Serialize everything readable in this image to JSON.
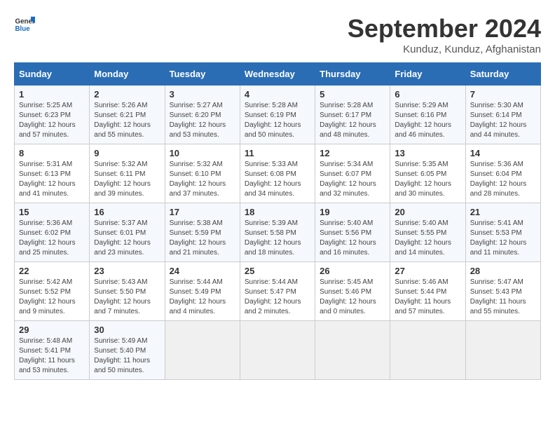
{
  "logo": {
    "line1": "General",
    "line2": "Blue"
  },
  "title": "September 2024",
  "subtitle": "Kunduz, Kunduz, Afghanistan",
  "days_header": [
    "Sunday",
    "Monday",
    "Tuesday",
    "Wednesday",
    "Thursday",
    "Friday",
    "Saturday"
  ],
  "weeks": [
    [
      {
        "num": "1",
        "sunrise": "5:25 AM",
        "sunset": "6:23 PM",
        "daylight": "12 hours and 57 minutes."
      },
      {
        "num": "2",
        "sunrise": "5:26 AM",
        "sunset": "6:21 PM",
        "daylight": "12 hours and 55 minutes."
      },
      {
        "num": "3",
        "sunrise": "5:27 AM",
        "sunset": "6:20 PM",
        "daylight": "12 hours and 53 minutes."
      },
      {
        "num": "4",
        "sunrise": "5:28 AM",
        "sunset": "6:19 PM",
        "daylight": "12 hours and 50 minutes."
      },
      {
        "num": "5",
        "sunrise": "5:28 AM",
        "sunset": "6:17 PM",
        "daylight": "12 hours and 48 minutes."
      },
      {
        "num": "6",
        "sunrise": "5:29 AM",
        "sunset": "6:16 PM",
        "daylight": "12 hours and 46 minutes."
      },
      {
        "num": "7",
        "sunrise": "5:30 AM",
        "sunset": "6:14 PM",
        "daylight": "12 hours and 44 minutes."
      }
    ],
    [
      {
        "num": "8",
        "sunrise": "5:31 AM",
        "sunset": "6:13 PM",
        "daylight": "12 hours and 41 minutes."
      },
      {
        "num": "9",
        "sunrise": "5:32 AM",
        "sunset": "6:11 PM",
        "daylight": "12 hours and 39 minutes."
      },
      {
        "num": "10",
        "sunrise": "5:32 AM",
        "sunset": "6:10 PM",
        "daylight": "12 hours and 37 minutes."
      },
      {
        "num": "11",
        "sunrise": "5:33 AM",
        "sunset": "6:08 PM",
        "daylight": "12 hours and 34 minutes."
      },
      {
        "num": "12",
        "sunrise": "5:34 AM",
        "sunset": "6:07 PM",
        "daylight": "12 hours and 32 minutes."
      },
      {
        "num": "13",
        "sunrise": "5:35 AM",
        "sunset": "6:05 PM",
        "daylight": "12 hours and 30 minutes."
      },
      {
        "num": "14",
        "sunrise": "5:36 AM",
        "sunset": "6:04 PM",
        "daylight": "12 hours and 28 minutes."
      }
    ],
    [
      {
        "num": "15",
        "sunrise": "5:36 AM",
        "sunset": "6:02 PM",
        "daylight": "12 hours and 25 minutes."
      },
      {
        "num": "16",
        "sunrise": "5:37 AM",
        "sunset": "6:01 PM",
        "daylight": "12 hours and 23 minutes."
      },
      {
        "num": "17",
        "sunrise": "5:38 AM",
        "sunset": "5:59 PM",
        "daylight": "12 hours and 21 minutes."
      },
      {
        "num": "18",
        "sunrise": "5:39 AM",
        "sunset": "5:58 PM",
        "daylight": "12 hours and 18 minutes."
      },
      {
        "num": "19",
        "sunrise": "5:40 AM",
        "sunset": "5:56 PM",
        "daylight": "12 hours and 16 minutes."
      },
      {
        "num": "20",
        "sunrise": "5:40 AM",
        "sunset": "5:55 PM",
        "daylight": "12 hours and 14 minutes."
      },
      {
        "num": "21",
        "sunrise": "5:41 AM",
        "sunset": "5:53 PM",
        "daylight": "12 hours and 11 minutes."
      }
    ],
    [
      {
        "num": "22",
        "sunrise": "5:42 AM",
        "sunset": "5:52 PM",
        "daylight": "12 hours and 9 minutes."
      },
      {
        "num": "23",
        "sunrise": "5:43 AM",
        "sunset": "5:50 PM",
        "daylight": "12 hours and 7 minutes."
      },
      {
        "num": "24",
        "sunrise": "5:44 AM",
        "sunset": "5:49 PM",
        "daylight": "12 hours and 4 minutes."
      },
      {
        "num": "25",
        "sunrise": "5:44 AM",
        "sunset": "5:47 PM",
        "daylight": "12 hours and 2 minutes."
      },
      {
        "num": "26",
        "sunrise": "5:45 AM",
        "sunset": "5:46 PM",
        "daylight": "12 hours and 0 minutes."
      },
      {
        "num": "27",
        "sunrise": "5:46 AM",
        "sunset": "5:44 PM",
        "daylight": "11 hours and 57 minutes."
      },
      {
        "num": "28",
        "sunrise": "5:47 AM",
        "sunset": "5:43 PM",
        "daylight": "11 hours and 55 minutes."
      }
    ],
    [
      {
        "num": "29",
        "sunrise": "5:48 AM",
        "sunset": "5:41 PM",
        "daylight": "11 hours and 53 minutes."
      },
      {
        "num": "30",
        "sunrise": "5:49 AM",
        "sunset": "5:40 PM",
        "daylight": "11 hours and 50 minutes."
      },
      null,
      null,
      null,
      null,
      null
    ]
  ]
}
